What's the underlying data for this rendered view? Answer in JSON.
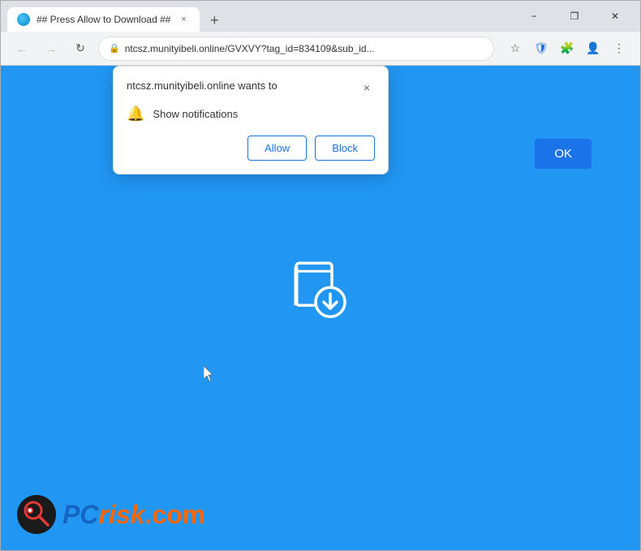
{
  "browser": {
    "tab": {
      "label": "## Press Allow to Download ##",
      "close_label": "×"
    },
    "new_tab_label": "+",
    "window_controls": {
      "minimize": "−",
      "maximize": "❐",
      "close": "✕"
    },
    "address_bar": {
      "url": "ntcsz.munityibeli.online/GVXVY?tag_id=834109&sub_id...",
      "lock_icon": "🔒"
    },
    "toolbar": {
      "back_icon": "←",
      "forward_icon": "→",
      "reload_icon": "↻",
      "bookmark_icon": "☆",
      "extension_icon": "🧩",
      "profile_icon": "👤",
      "menu_icon": "⋮",
      "shield_icon": "🛡"
    }
  },
  "popup": {
    "title": "ntcsz.munityibeli.online wants to",
    "permission_label": "Show notifications",
    "close_label": "×",
    "allow_label": "Allow",
    "block_label": "Block"
  },
  "page": {
    "ok_label": "OK",
    "background_color": "#2196f3"
  },
  "watermark": {
    "pc": "PC",
    "risk": "risk",
    "dot_com": ".com"
  }
}
